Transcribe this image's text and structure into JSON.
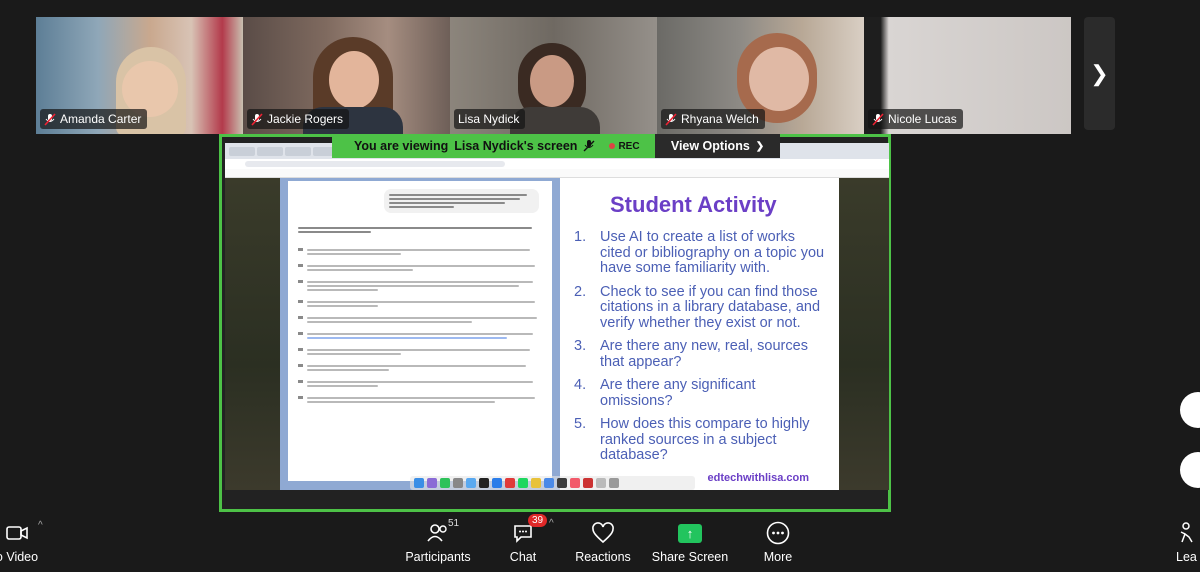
{
  "participants_strip": [
    {
      "name": "Amanda Carter",
      "muted": true,
      "active": false
    },
    {
      "name": "Jackie Rogers",
      "muted": true,
      "active": false
    },
    {
      "name": "Lisa Nydick",
      "muted": false,
      "active": true
    },
    {
      "name": "Rhyana Welch",
      "muted": true,
      "active": false
    },
    {
      "name": "Nicole Lucas",
      "muted": true,
      "active": false
    }
  ],
  "share_banner": {
    "prefix": "You are viewing",
    "who": "Lisa Nydick's screen",
    "rec": "REC",
    "view_options": "View Options"
  },
  "slide": {
    "title": "Student Activity",
    "items": [
      {
        "num": "1.",
        "text": "Use AI to create a list of works cited or bibliography on a topic you have some familiarity with."
      },
      {
        "num": "2.",
        "text": "Check to see if you can find those citations in a library database, and verify whether they exist or not."
      },
      {
        "num": "3.",
        "text": "Are there any new, real, sources that appear?"
      },
      {
        "num": "4.",
        "text": "Are there any significant omissions?"
      },
      {
        "num": "5.",
        "text": "How does this compare to highly ranked sources in a subject database?"
      }
    ],
    "footer": "edtechwithlisa.com"
  },
  "toolbar": {
    "video_label": "o Video",
    "participants_label": "Participants",
    "participants_count": "51",
    "chat_label": "Chat",
    "chat_badge": "39",
    "reactions_label": "Reactions",
    "share_label": "Share Screen",
    "more_label": "More",
    "leave_label": "Lea"
  },
  "colors": {
    "share_green": "#4dc247",
    "slide_purple": "#6b3fc6",
    "slide_blue": "#4b5fb5",
    "chat_badge_red": "#e02828"
  }
}
